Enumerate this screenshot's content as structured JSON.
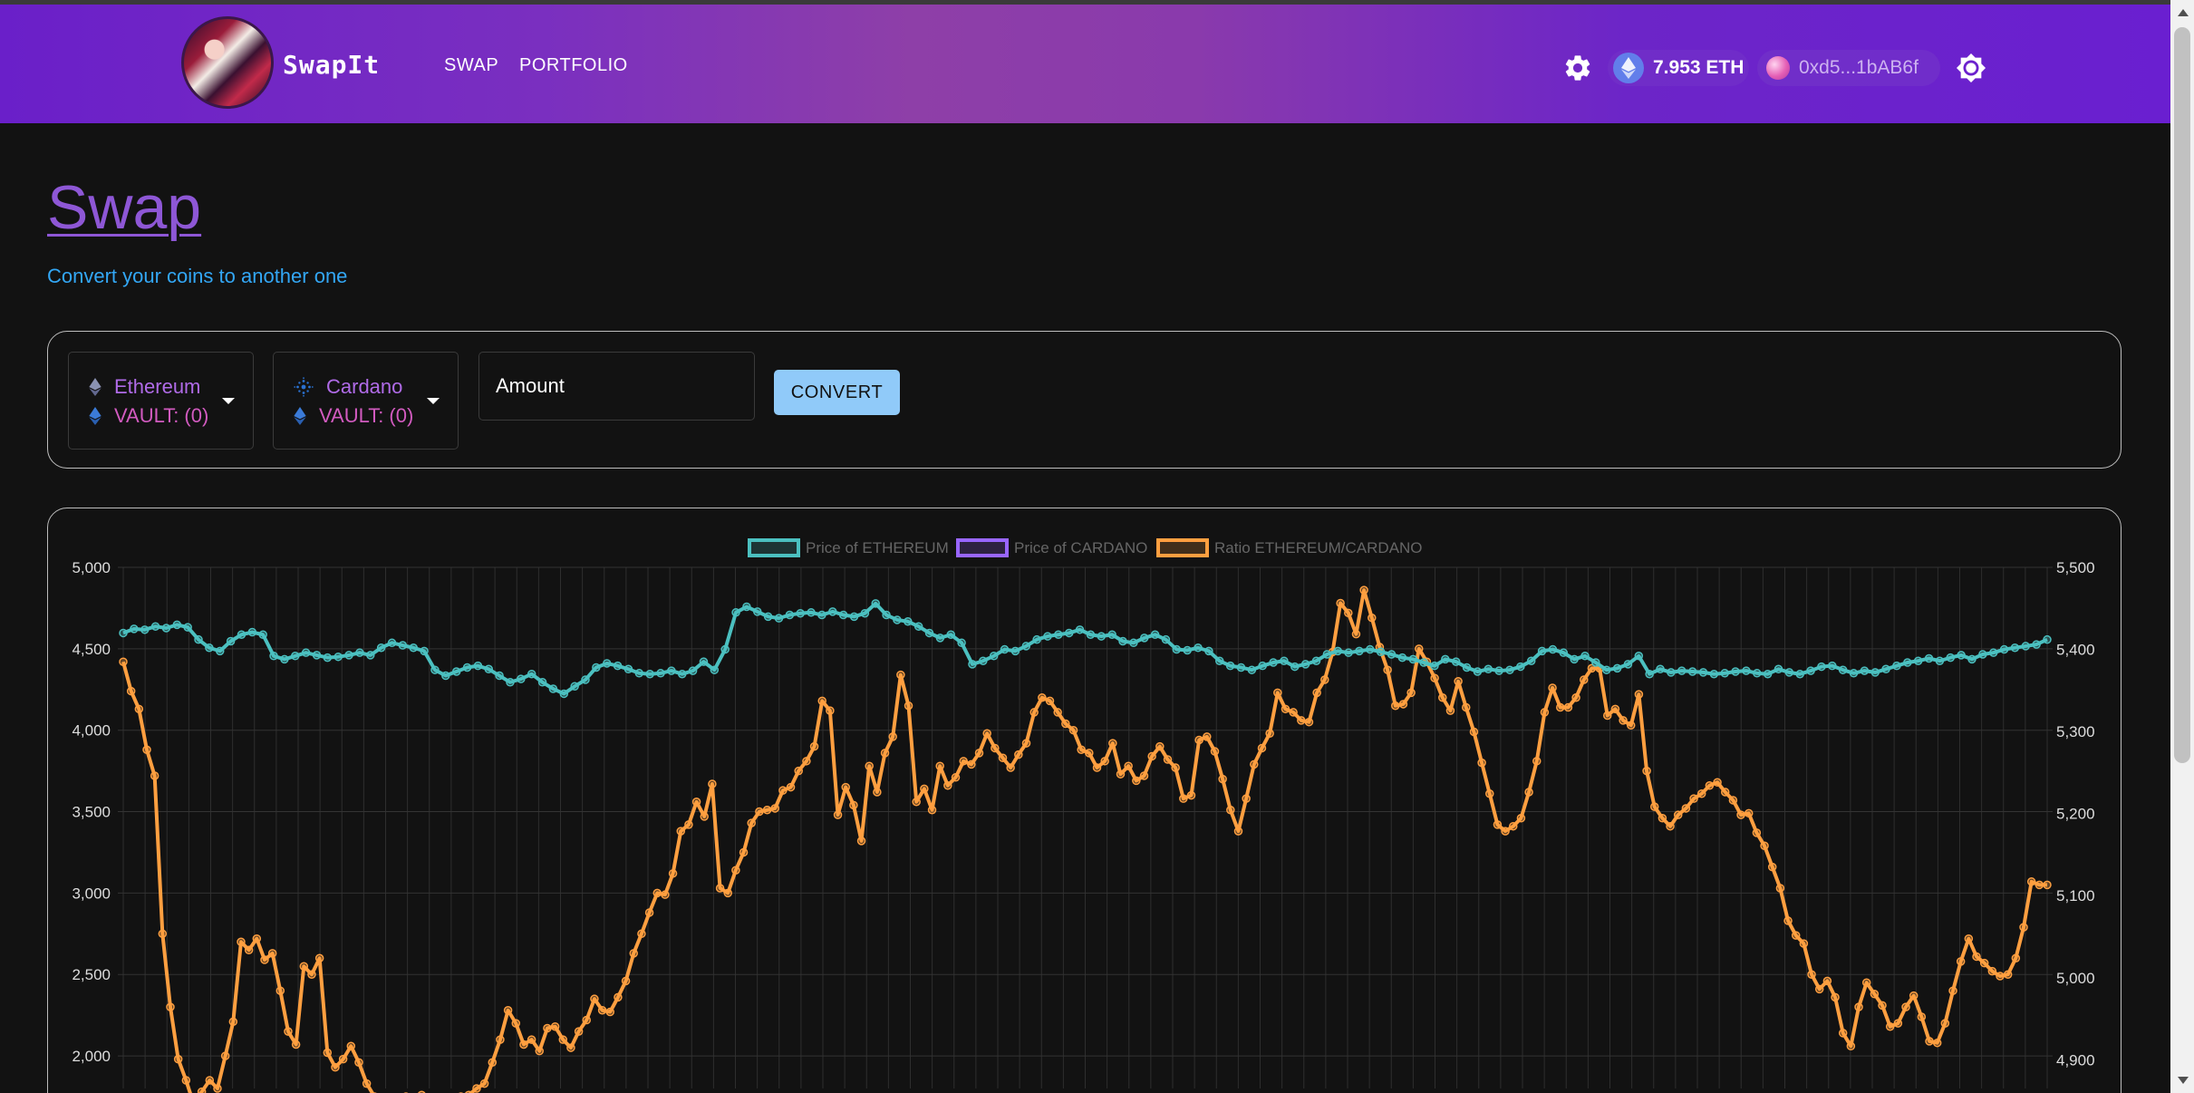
{
  "header": {
    "brand": "SwapIt",
    "nav": [
      {
        "label": "SWAP"
      },
      {
        "label": "PORTFOLIO"
      }
    ],
    "eth_balance": "7.953 ETH",
    "account": "0xd5...1bAB6f"
  },
  "page": {
    "title": "Swap",
    "subtitle": "Convert your coins to another one"
  },
  "swap": {
    "from": {
      "coin": "Ethereum",
      "vault": "VAULT: (0)",
      "icon": "ethereum-icon"
    },
    "to": {
      "coin": "Cardano",
      "vault": "VAULT: (0)",
      "icon": "cardano-icon"
    },
    "amount_placeholder": "Amount",
    "convert_label": "CONVERT"
  },
  "colors": {
    "accent": "#8e57d6",
    "link": "#33a7f5",
    "button": "#90caf9",
    "series_eth": "#4bc0c0",
    "series_ada": "#9966ff",
    "series_ratio": "#ff9f40"
  },
  "chart_data": {
    "type": "line",
    "legend": [
      "Price of ETHEREUM",
      "Price of CARDANO",
      "Ratio ETHEREUM/CARDANO"
    ],
    "legend_position": "top-center",
    "grid": true,
    "y_left_ticks": [
      "5,000",
      "4,500",
      "4,000",
      "3,500",
      "3,000",
      "2,500",
      "2,000"
    ],
    "y_right_ticks": [
      "5,500",
      "5,400",
      "5,300",
      "5,200",
      "5,100",
      "5,000",
      "4,900"
    ],
    "ylim_left": [
      1800,
      5000
    ],
    "ylim_right": [
      4865,
      5500
    ],
    "series": [
      {
        "name": "Price of ETHEREUM",
        "axis": "right",
        "values": [
          5420,
          5425,
          5424,
          5428,
          5426,
          5430,
          5427,
          5412,
          5402,
          5398,
          5410,
          5418,
          5421,
          5418,
          5392,
          5388,
          5392,
          5396,
          5393,
          5390,
          5391,
          5393,
          5396,
          5393,
          5402,
          5408,
          5405,
          5402,
          5398,
          5375,
          5368,
          5373,
          5378,
          5380,
          5376,
          5368,
          5360,
          5364,
          5370,
          5360,
          5352,
          5346,
          5355,
          5363,
          5378,
          5383,
          5380,
          5376,
          5371,
          5370,
          5371,
          5374,
          5370,
          5374,
          5385,
          5375,
          5400,
          5445,
          5452,
          5446,
          5440,
          5438,
          5442,
          5444,
          5445,
          5442,
          5446,
          5442,
          5440,
          5444,
          5456,
          5442,
          5436,
          5434,
          5428,
          5420,
          5414,
          5418,
          5408,
          5382,
          5386,
          5392,
          5400,
          5398,
          5404,
          5412,
          5416,
          5418,
          5420,
          5424,
          5418,
          5416,
          5418,
          5410,
          5408,
          5414,
          5418,
          5412,
          5400,
          5399,
          5402,
          5398,
          5386,
          5380,
          5378,
          5375,
          5380,
          5384,
          5386,
          5379,
          5382,
          5386,
          5394,
          5398,
          5396,
          5398,
          5400,
          5397,
          5394,
          5390,
          5388,
          5384,
          5380,
          5388,
          5385,
          5378,
          5373,
          5376,
          5374,
          5375,
          5379,
          5386,
          5398,
          5400,
          5396,
          5388,
          5392,
          5384,
          5375,
          5377,
          5382,
          5392,
          5370,
          5376,
          5372,
          5374,
          5373,
          5372,
          5370,
          5371,
          5373,
          5374,
          5371,
          5370,
          5376,
          5372,
          5370,
          5374,
          5379,
          5380,
          5375,
          5371,
          5374,
          5372,
          5376,
          5380,
          5384,
          5386,
          5389,
          5386,
          5390,
          5393,
          5388,
          5394,
          5396,
          5400,
          5402,
          5404,
          5406,
          5412
        ]
      },
      {
        "name": "Price of CARDANO",
        "axis": "left",
        "values": []
      },
      {
        "name": "Ratio ETHEREUM/CARDANO",
        "axis": "left",
        "values": [
          4420,
          4240,
          4130,
          3880,
          3720,
          2750,
          2300,
          1980,
          1850,
          1700,
          1780,
          1850,
          1800,
          2000,
          2210,
          2700,
          2650,
          2720,
          2590,
          2630,
          2400,
          2150,
          2070,
          2550,
          2500,
          2600,
          2020,
          1930,
          1980,
          2060,
          1960,
          1830,
          1750,
          1700,
          1720,
          1710,
          1750,
          1740,
          1760,
          1700,
          1680,
          1710,
          1730,
          1750,
          1760,
          1800,
          1830,
          1960,
          2100,
          2280,
          2200,
          2070,
          2100,
          2030,
          2170,
          2180,
          2100,
          2050,
          2150,
          2220,
          2350,
          2280,
          2270,
          2360,
          2460,
          2630,
          2750,
          2880,
          3000,
          2990,
          3120,
          3380,
          3420,
          3560,
          3470,
          3670,
          3030,
          3000,
          3140,
          3250,
          3430,
          3500,
          3510,
          3520,
          3630,
          3650,
          3750,
          3810,
          3900,
          4180,
          4120,
          3480,
          3650,
          3540,
          3320,
          3780,
          3620,
          3860,
          3960,
          4340,
          4150,
          3560,
          3640,
          3510,
          3780,
          3660,
          3710,
          3810,
          3790,
          3860,
          3980,
          3890,
          3830,
          3770,
          3850,
          3920,
          4110,
          4200,
          4180,
          4110,
          4040,
          4000,
          3880,
          3860,
          3770,
          3810,
          3920,
          3730,
          3780,
          3690,
          3720,
          3840,
          3900,
          3820,
          3770,
          3580,
          3600,
          3940,
          3960,
          3870,
          3700,
          3510,
          3380,
          3580,
          3790,
          3890,
          3980,
          4230,
          4130,
          4110,
          4060,
          4050,
          4230,
          4310,
          4480,
          4780,
          4720,
          4590,
          4860,
          4690,
          4510,
          4370,
          4150,
          4160,
          4230,
          4500,
          4420,
          4320,
          4200,
          4120,
          4300,
          4140,
          3990,
          3800,
          3610,
          3420,
          3380,
          3410,
          3460,
          3620,
          3810,
          4110,
          4260,
          4140,
          4140,
          4200,
          4310,
          4380,
          4380,
          4090,
          4130,
          4060,
          4030,
          4220,
          3750,
          3530,
          3460,
          3410,
          3480,
          3520,
          3580,
          3610,
          3660,
          3680,
          3620,
          3570,
          3480,
          3490,
          3370,
          3290,
          3160,
          3030,
          2830,
          2740,
          2690,
          2500,
          2410,
          2460,
          2360,
          2140,
          2060,
          2300,
          2450,
          2380,
          2310,
          2180,
          2200,
          2300,
          2370,
          2240,
          2090,
          2080,
          2200,
          2400,
          2580,
          2720,
          2610,
          2570,
          2520,
          2490,
          2500,
          2600,
          2790,
          3070,
          3050,
          3050
        ]
      }
    ]
  }
}
